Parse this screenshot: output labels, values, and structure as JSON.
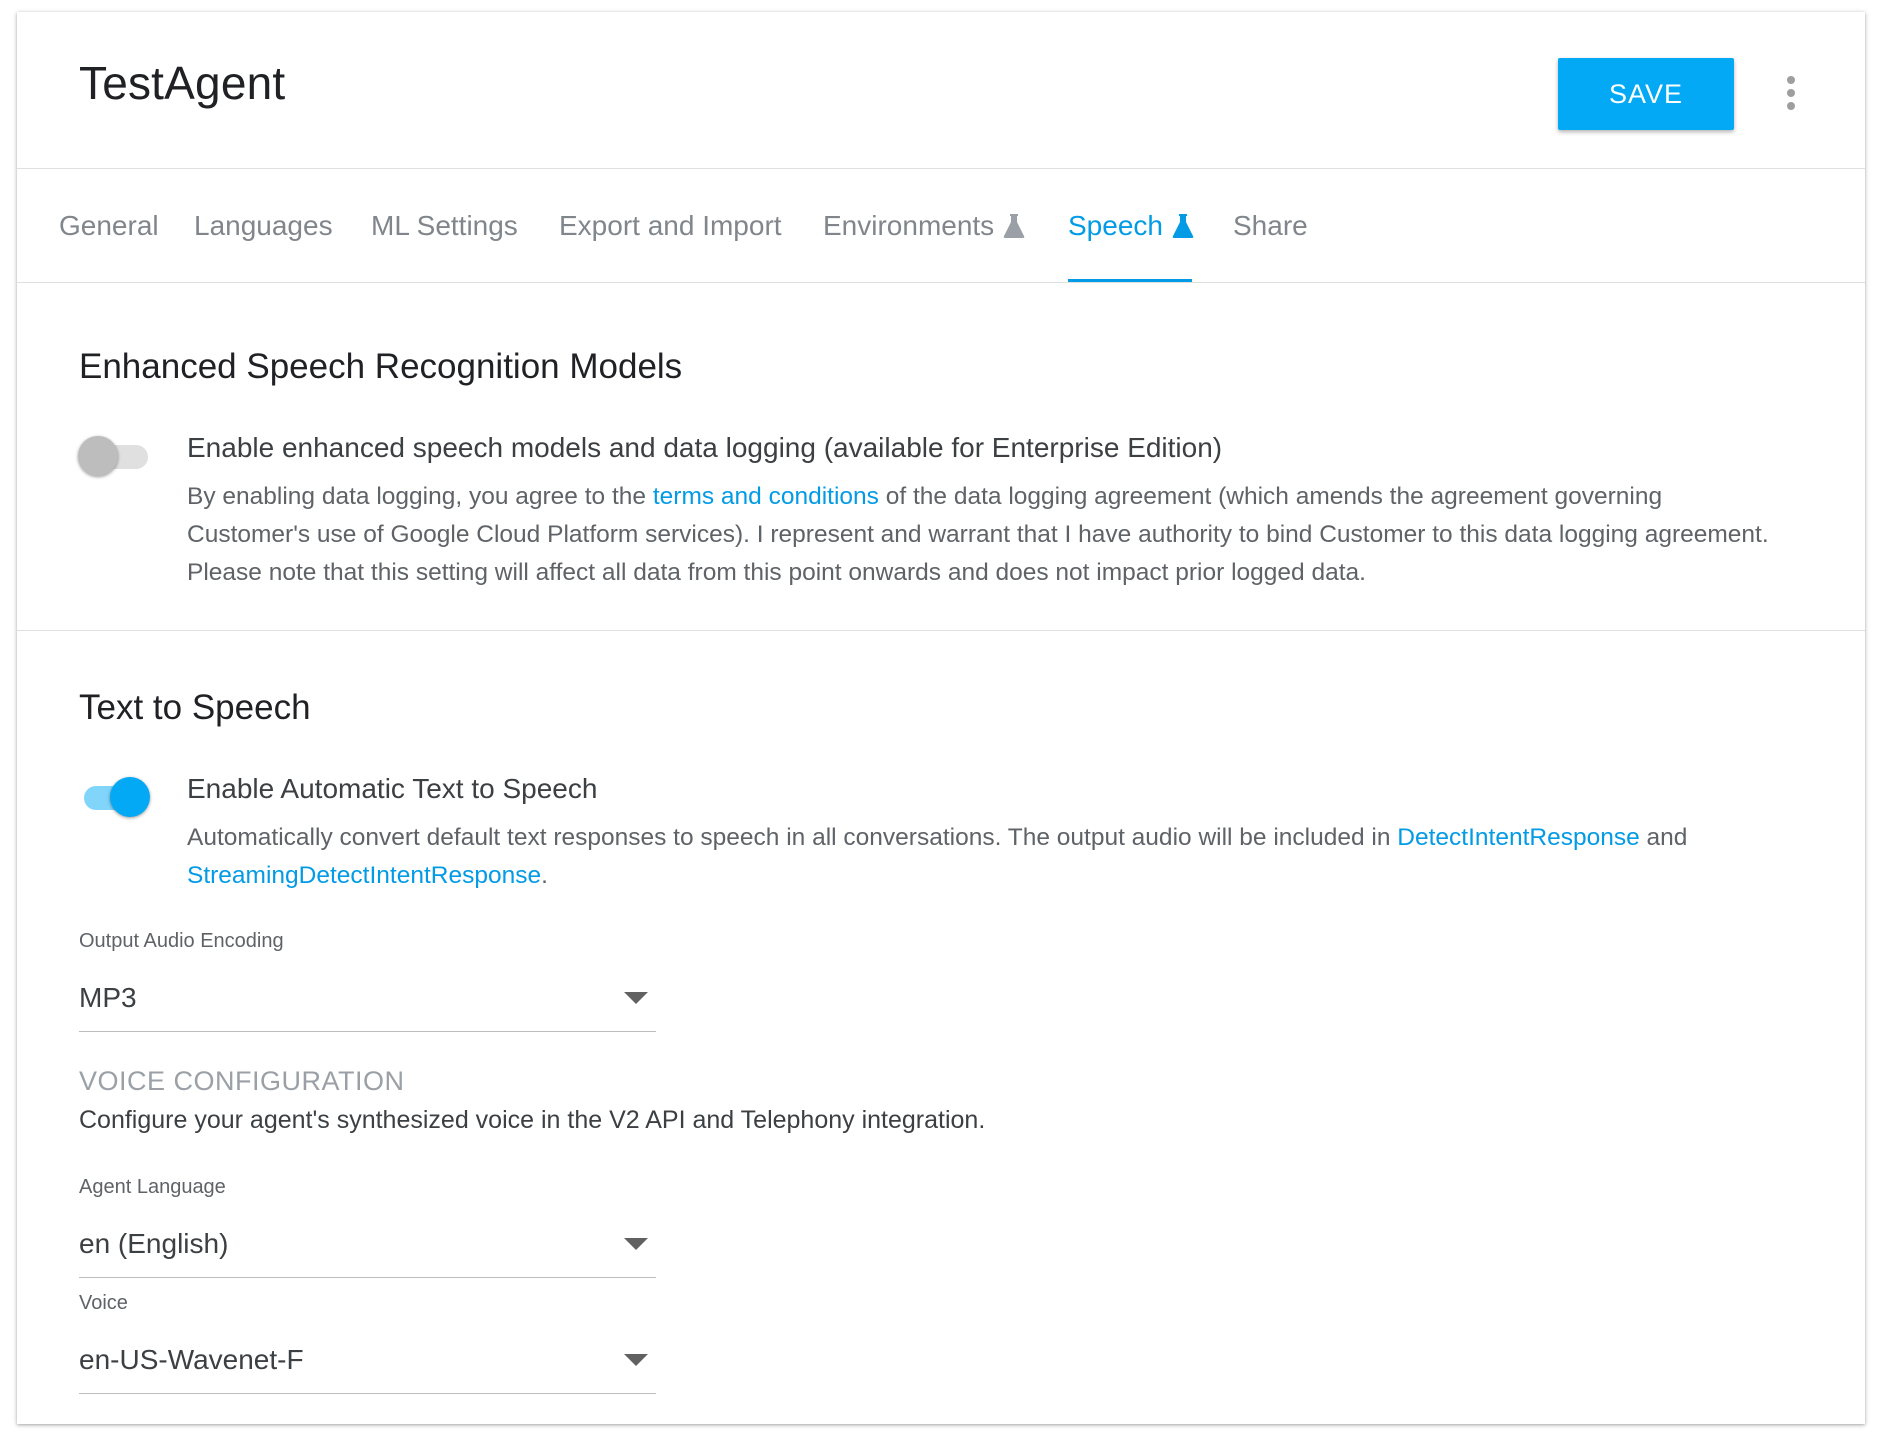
{
  "header": {
    "agent_name": "TestAgent",
    "save_label": "SAVE",
    "more_icon": "more-vert-icon"
  },
  "tabs": [
    {
      "label": "General",
      "active": false,
      "beta": false
    },
    {
      "label": "Languages",
      "active": false,
      "beta": false
    },
    {
      "label": "ML Settings",
      "active": false,
      "beta": false
    },
    {
      "label": "Export and Import",
      "active": false,
      "beta": false
    },
    {
      "label": "Environments",
      "active": false,
      "beta": true
    },
    {
      "label": "Speech",
      "active": true,
      "beta": true
    },
    {
      "label": "Share",
      "active": false,
      "beta": false
    }
  ],
  "enhanced_speech": {
    "title": "Enhanced Speech Recognition Models",
    "toggle_on": false,
    "label": "Enable enhanced speech models and data logging (available for Enterprise Edition)",
    "desc_before": "By enabling data logging, you agree to the ",
    "desc_link": "terms and conditions",
    "desc_after": " of the data logging agreement (which amends the agreement governing Customer's use of Google Cloud Platform services). I represent and warrant that I have authority to bind Customer to this data logging agreement. Please note that this setting will affect all data from this point onwards and does not impact prior logged data."
  },
  "text_to_speech": {
    "title": "Text to Speech",
    "toggle_on": true,
    "label": "Enable Automatic Text to Speech",
    "desc_before": "Automatically convert default text responses to speech in all conversations. The output audio will be included in ",
    "desc_link1": "DetectIntentResponse",
    "desc_middle": " and ",
    "desc_link2": "StreamingDetectIntentResponse",
    "desc_after": ".",
    "output_encoding_label": "Output Audio Encoding",
    "output_encoding_value": "MP3",
    "voice_config_heading": "VOICE CONFIGURATION",
    "voice_config_desc": "Configure your agent's synthesized voice in the V2 API and Telephony integration.",
    "agent_language_label": "Agent Language",
    "agent_language_value": "en (English)",
    "voice_label": "Voice",
    "voice_value": "en-US-Wavenet-F"
  },
  "colors": {
    "accent": "#039be5",
    "save_button": "#03a9f4",
    "muted_text": "#80868b"
  }
}
